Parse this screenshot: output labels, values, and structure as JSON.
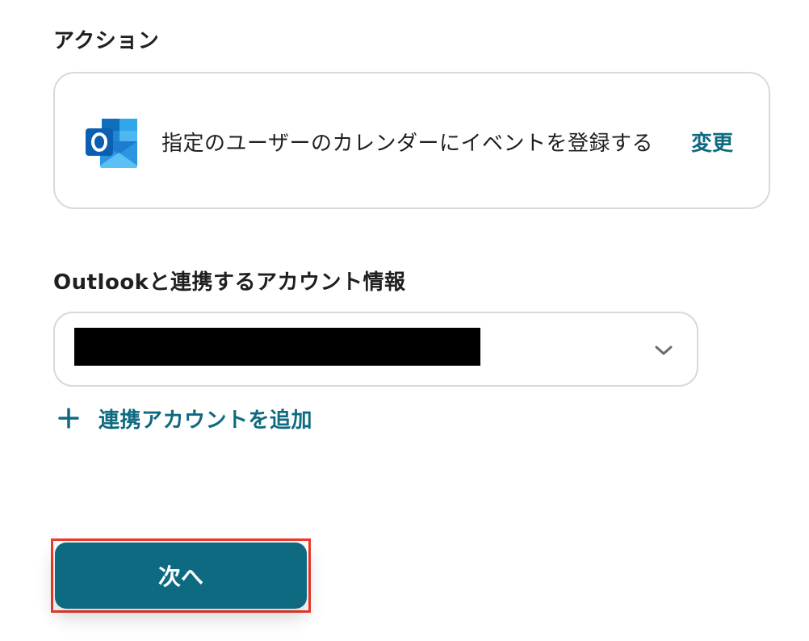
{
  "action_section": {
    "label": "アクション",
    "card": {
      "app_icon": "outlook-icon",
      "action_text": "指定のユーザーのカレンダーにイベントを登録する",
      "change_label": "変更"
    }
  },
  "account_section": {
    "label": "Outlookと連携するアカウント情報",
    "select": {
      "value_redacted": true,
      "dropdown_icon": "chevron-down-icon"
    },
    "add_account_icon": "plus-icon",
    "add_account_label": "連携アカウントを追加"
  },
  "next_button": {
    "label": "次へ"
  },
  "colors": {
    "accent": "#0e6a80",
    "highlight_border": "#ee3a2a",
    "card_border": "#d9d9d9",
    "text": "#1f1f1f"
  }
}
